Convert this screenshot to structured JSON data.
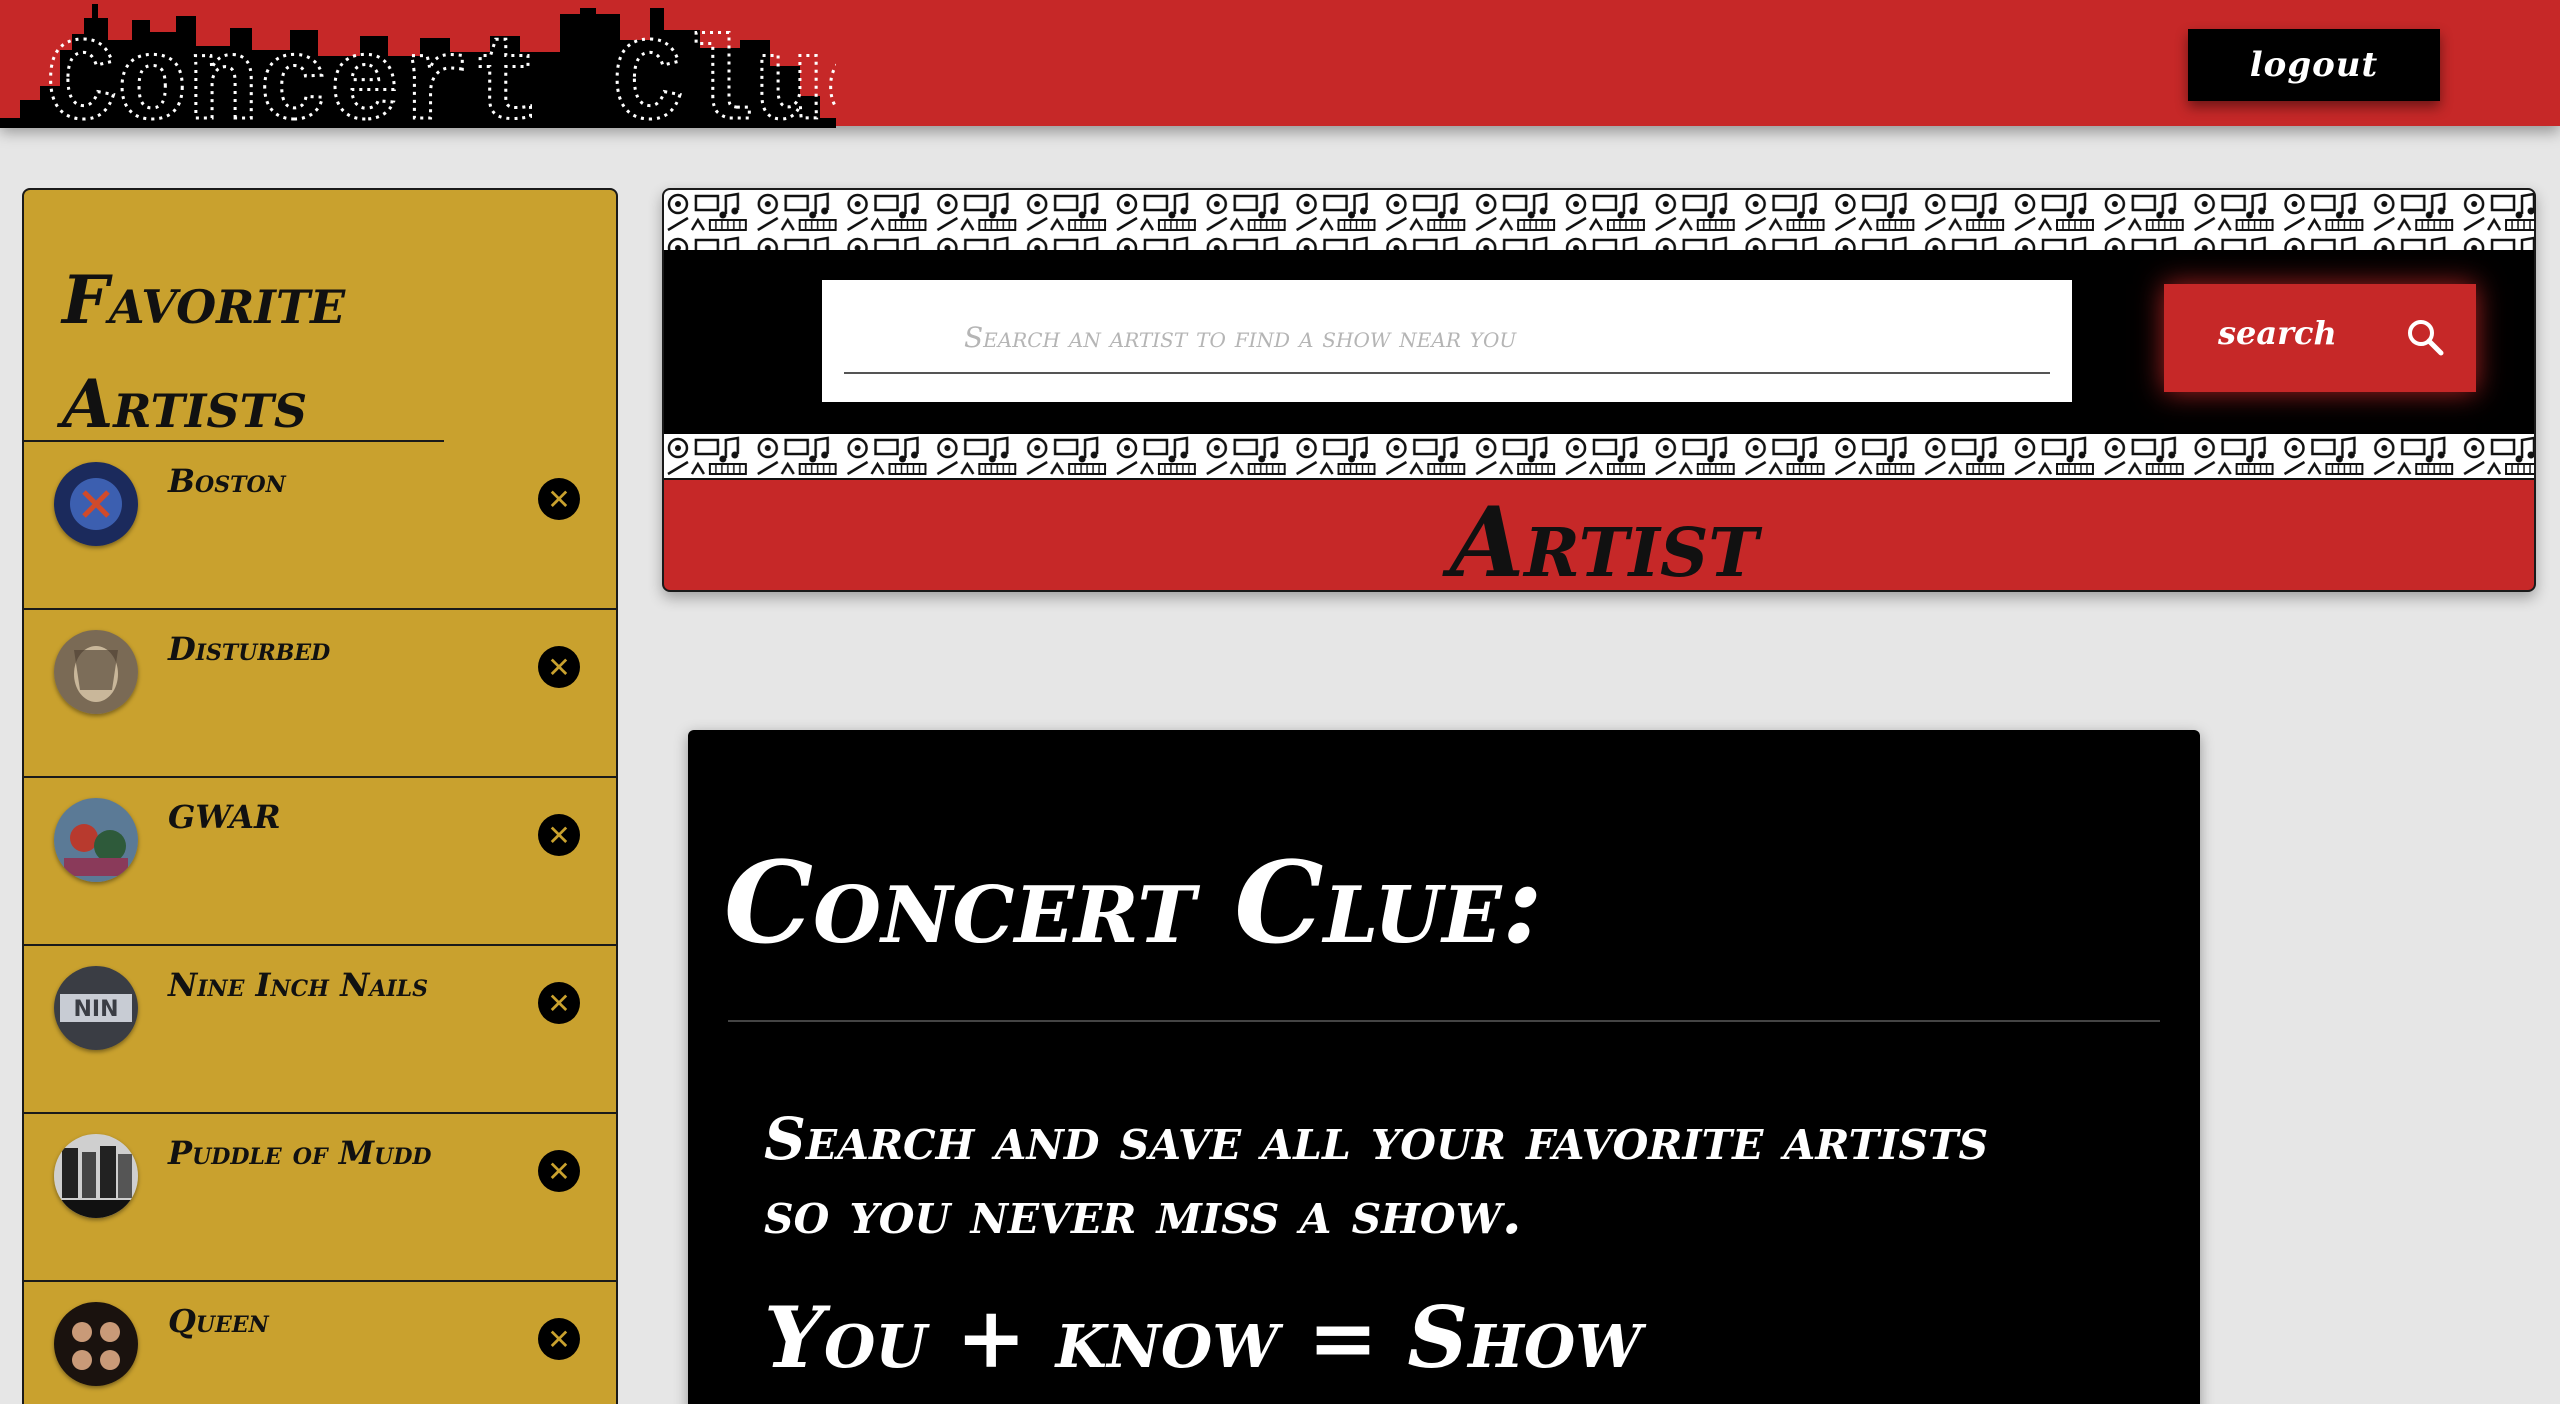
{
  "header": {
    "logo_text": "Concert Clue",
    "logout_label": "logout"
  },
  "sidebar": {
    "title": "Favorite Artists",
    "items": [
      {
        "name": "Boston",
        "avatar_color": "#1b2a5c"
      },
      {
        "name": "Disturbed",
        "avatar_color": "#7a6a55"
      },
      {
        "name": "GWAR",
        "avatar_color": "#5b7a96"
      },
      {
        "name": "Nine Inch Nails",
        "avatar_color": "#6a6f78"
      },
      {
        "name": "Puddle of Mudd",
        "avatar_color": "#9a9a9a"
      },
      {
        "name": "Queen",
        "avatar_color": "#2a1e18"
      }
    ],
    "remove_icon": "close-icon"
  },
  "search": {
    "placeholder": "Search an artist to find a show near you",
    "button_label": "search",
    "button_icon": "search-icon",
    "band_title": "Artist"
  },
  "info": {
    "title": "Concert Clue:",
    "body": "Search and save all your favorite artists so you never miss a show.",
    "equation": "You + know = Show"
  },
  "colors": {
    "brand_red": "#c62828",
    "gold": "#c9a12e",
    "black": "#000000",
    "background": "#e6e6e6"
  }
}
